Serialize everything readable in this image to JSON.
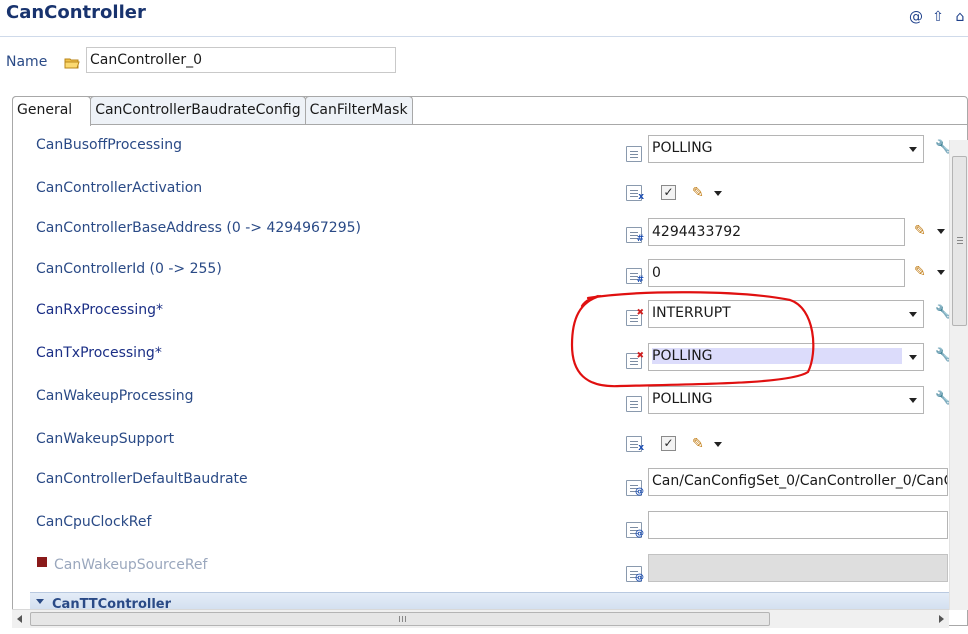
{
  "header": {
    "title": "CanController",
    "tools": [
      "@",
      "⇧",
      "⌂"
    ]
  },
  "name_field": {
    "label": "Name",
    "value": "CanController_0"
  },
  "tabs": [
    {
      "label": "General",
      "active": true
    },
    {
      "label": "CanControllerBaudrateConfig",
      "active": false
    },
    {
      "label": "CanFilterMask",
      "active": false
    }
  ],
  "params": {
    "busoff": {
      "label": "CanBusoffProcessing",
      "value": "POLLING"
    },
    "activation": {
      "label": "CanControllerActivation",
      "checked": true
    },
    "base_address": {
      "label": "CanControllerBaseAddress (0 -> 4294967295)",
      "value": "4294433792"
    },
    "controller_id": {
      "label": "CanControllerId (0 -> 255)",
      "value": "0"
    },
    "rx": {
      "label": "CanRxProcessing*",
      "value": "INTERRUPT"
    },
    "tx": {
      "label": "CanTxProcessing*",
      "value": "POLLING"
    },
    "wakeup_processing": {
      "label": "CanWakeupProcessing",
      "value": "POLLING"
    },
    "wakeup_support": {
      "label": "CanWakeupSupport",
      "checked": true
    },
    "default_baudrate": {
      "label": "CanControllerDefaultBaudrate",
      "value": "Can/CanConfigSet_0/CanController_0/CanCon"
    },
    "cpu_clock_ref": {
      "label": "CanCpuClockRef",
      "value": ""
    },
    "wakeup_source_ref": {
      "label": "CanWakeupSourceRef",
      "value": ""
    }
  },
  "section": {
    "label": "CanTTController"
  },
  "scrollbar": {
    "grip": "III"
  },
  "colors": {
    "label_blue": "#2a4a86",
    "title_blue": "#18336e",
    "highlight": "#dcdcfb",
    "annotation_red": "#e01010"
  }
}
